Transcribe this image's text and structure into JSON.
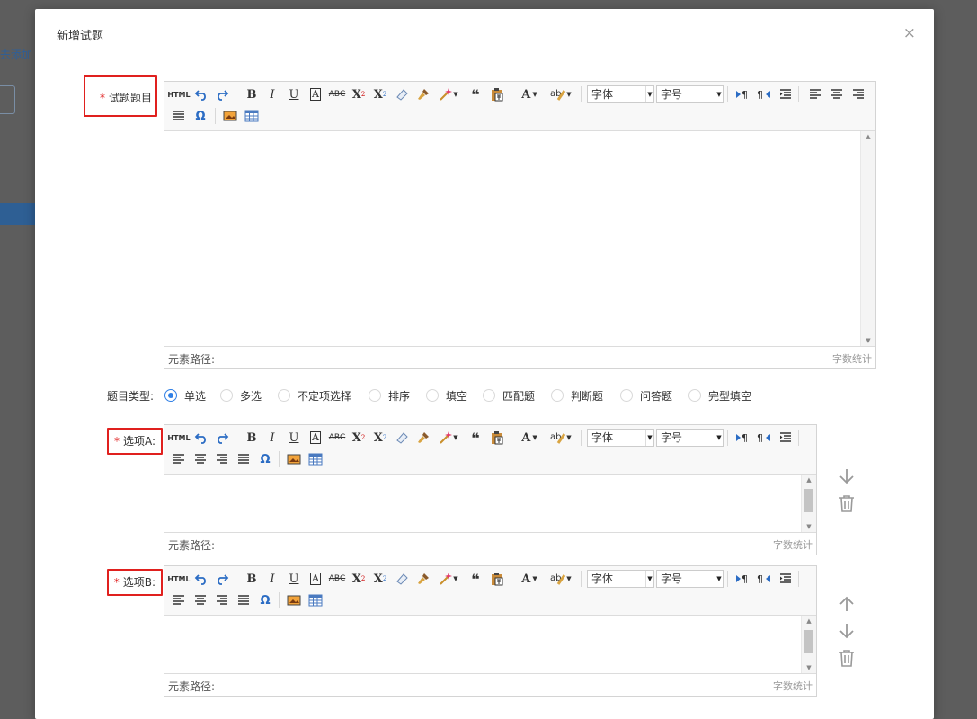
{
  "background": {
    "link_text": "去添加"
  },
  "modal": {
    "title": "新增试题",
    "close": "×"
  },
  "toolbar": {
    "html": "HTML",
    "font_family": "字体",
    "font_size": "字号"
  },
  "question": {
    "label": "试题题目",
    "required": "*",
    "footer_path": "元素路径:",
    "footer_count": "字数统计"
  },
  "question_type": {
    "label": "题目类型:",
    "selected": "单选",
    "options": [
      "单选",
      "多选",
      "不定项选择",
      "排序",
      "填空",
      "匹配题",
      "判断题",
      "问答题",
      "完型填空"
    ]
  },
  "options": [
    {
      "label": "选项A:",
      "required": "*",
      "footer_path": "元素路径:",
      "footer_count": "字数统计"
    },
    {
      "label": "选项B:",
      "required": "*",
      "footer_path": "元素路径:",
      "footer_count": "字数统计"
    }
  ]
}
